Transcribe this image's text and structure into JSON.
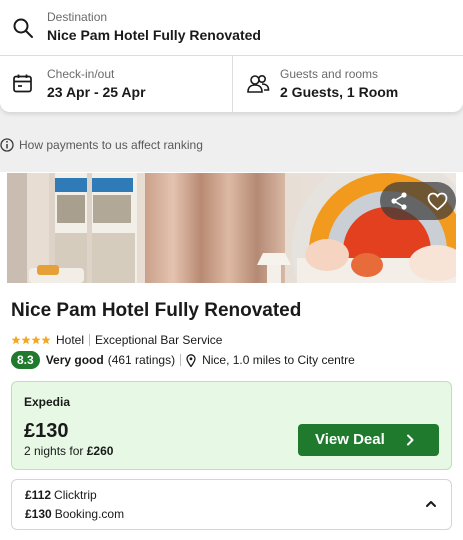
{
  "search": {
    "destination_label": "Destination",
    "destination_value": "Nice Pam Hotel Fully Renovated",
    "checkin_label": "Check-in/out",
    "checkin_value": "23 Apr - 25 Apr",
    "guests_label": "Guests and rooms",
    "guests_value": "2 Guests, 1 Room"
  },
  "ranking_note": "How payments to us affect ranking",
  "hotel": {
    "name": "Nice Pam Hotel Fully Renovated",
    "stars": 4,
    "type": "Hotel",
    "highlight": "Exceptional Bar Service",
    "score": "8.3",
    "rating_word": "Very good",
    "ratings_count": "(461 ratings)",
    "location": "Nice, 1.0 miles to City centre"
  },
  "deal": {
    "provider": "Expedia",
    "price": "£130",
    "nights_text": "2 nights for",
    "total": "£260",
    "button_label": "View Deal"
  },
  "other_deals": [
    {
      "price": "£112",
      "provider": "Clicktrip"
    },
    {
      "price": "£130",
      "provider": "Booking.com"
    }
  ],
  "colors": {
    "accent_green": "#1f7a2e",
    "deal_background": "#e7f8e5",
    "star_color": "#f5a623"
  },
  "icons": [
    "search-icon",
    "calendar-icon",
    "guests-icon",
    "info-icon",
    "share-icon",
    "heart-icon",
    "star-icon",
    "map-pin-icon",
    "chevron-right-icon",
    "chevron-up-icon"
  ]
}
